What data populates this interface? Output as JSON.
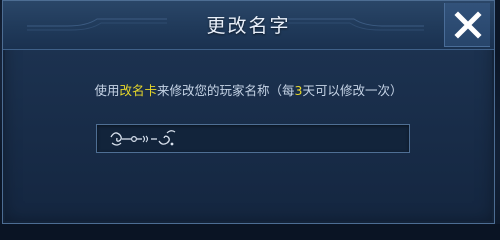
{
  "dialog": {
    "title": "更改名字",
    "close_icon": "close-x-icon",
    "prompt": {
      "before": "使用",
      "card_name": "改名卡",
      "middle": "来修改您的玩家名称（每",
      "days": "3",
      "after": "天可以修改一次）"
    },
    "input": {
      "value": "",
      "decoration_icon": "ornamental-flourish-icon"
    }
  },
  "colors": {
    "highlight": "#e8d82a",
    "text": "#c6d4e6",
    "title": "#e9f0fa",
    "panel": "#1c3250",
    "border": "#4d6d93"
  }
}
